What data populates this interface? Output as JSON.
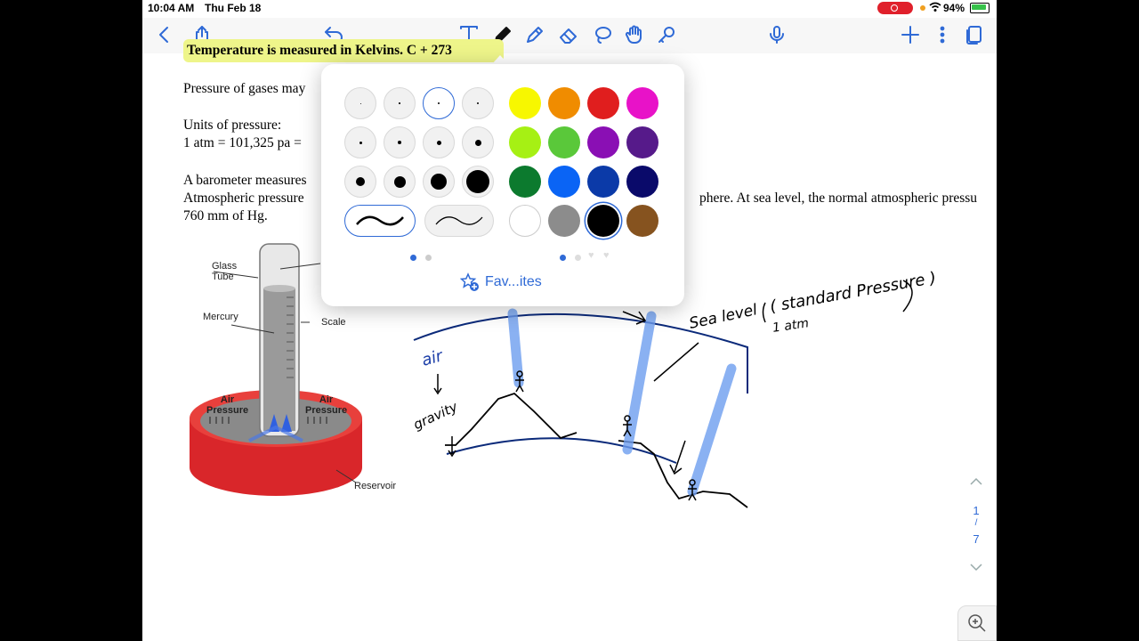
{
  "status_bar": {
    "time": "10:04 AM",
    "date": "Thu Feb 18",
    "battery": "94%"
  },
  "toolbar": {
    "icons": [
      "back-chevron-icon",
      "share-icon",
      "undo-icon",
      "text-tool-icon",
      "pen-tool-icon",
      "highlighter-tool-icon",
      "eraser-tool-icon",
      "lasso-tool-icon",
      "hand-tool-icon",
      "laser-tool-icon",
      "microphone-icon",
      "add-icon",
      "more-icon",
      "pages-icon"
    ]
  },
  "document": {
    "highlight_line": "Temperature is measured in Kelvins.  C + 273",
    "line1": "Pressure of gases may",
    "line2": "Units of pressure:",
    "line3": "1 atm = 101,325 pa =",
    "line4": "A barometer measures",
    "line5a": "Atmospheric pressure",
    "line5b": "phere.  At sea level, the normal atmospheric pressu",
    "line6": "760 mm of Hg."
  },
  "diagram": {
    "glass_tube": "Glass\nTube",
    "mercury": "Mercury",
    "scale": "Scale",
    "air_pressure_left": "Air\nPressure",
    "air_pressure_right": "Air\nPressure",
    "reservoir": "Reservoir"
  },
  "handwriting": {
    "sea_level": "Sea level",
    "standard_pressure": "( standard Pressure )",
    "one_atm": "1 atm",
    "air": "air",
    "gravity": "gravity"
  },
  "pen_popover": {
    "colors": [
      "#f7f700",
      "#f08c00",
      "#e01e1e",
      "#e812c8",
      "#a6f014",
      "#5ac83a",
      "#8a0fb4",
      "#561a8a",
      "#0c7a2e",
      "#0a64f5",
      "#0b3aa8",
      "#0a0a6a",
      "#ffffff",
      "#8c8c8c",
      "#000000",
      "#86531f"
    ],
    "selected_color": "#000000",
    "favorites_label": "Fav...ites"
  },
  "page_nav": {
    "current": "1",
    "separator": "/",
    "total": "7"
  }
}
